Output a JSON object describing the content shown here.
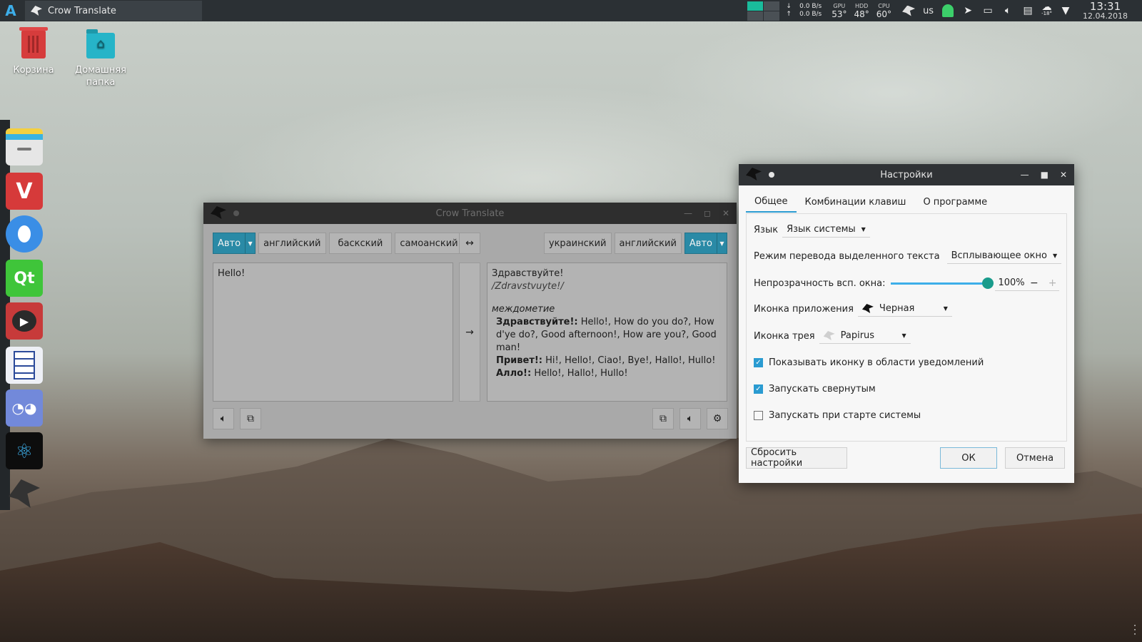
{
  "taskbar": {
    "task_title": "Crow Translate",
    "net_down": "0.0 B/s",
    "net_up": "0.0 B/s",
    "sensors": [
      {
        "label": "GPU",
        "value": "53°"
      },
      {
        "label": "HDD",
        "value": "48°"
      },
      {
        "label": "CPU",
        "value": "60°"
      }
    ],
    "keyboard_layout": "us",
    "weather_temp": "-18°",
    "time": "13:31",
    "date": "12.04.2018"
  },
  "desktop": {
    "trash_label": "Корзина",
    "home_label": "Домашняя папка"
  },
  "dock": {
    "qt_label": "Qt"
  },
  "crow": {
    "title": "Crow Translate",
    "source_langs": [
      "Авто",
      "английский",
      "баскский",
      "самоанский"
    ],
    "target_langs": [
      "украинский",
      "английский",
      "Авто"
    ],
    "swap_icon": "↔",
    "translate_icon": "→",
    "source_text": "Hello!",
    "result": {
      "main": "Здравствуйте!",
      "translit": "/Zdravstvuyte!/",
      "part_of_speech": "междометие",
      "entries": [
        {
          "word": "Здравствуйте!:",
          "meaning": "Hello!, How do you do?, How d'ye do?, Good afternoon!, How are you?, Good man!"
        },
        {
          "word": "Привет!:",
          "meaning": "Hi!, Hello!, Ciao!, Bye!, Hallo!, Hullo!"
        },
        {
          "word": "Алло!:",
          "meaning": "Hello!, Hallo!, Hullo!"
        }
      ]
    }
  },
  "settings": {
    "title": "Настройки",
    "tabs": [
      "Общее",
      "Комбинации клавиш",
      "О программе"
    ],
    "language_label": "Язык",
    "language_value": "Язык системы",
    "translation_mode_label": "Режим перевода выделенного текста",
    "translation_mode_value": "Всплывающее окно",
    "opacity_label": "Непрозрачность всп. окна:",
    "opacity_value": "100%",
    "opacity_fraction": 1.0,
    "app_icon_label": "Иконка приложения",
    "app_icon_value": "Черная",
    "tray_icon_label": "Иконка трея",
    "tray_icon_value": "Papirus",
    "checkboxes": [
      {
        "label": "Показывать иконку в области уведомлений",
        "checked": true
      },
      {
        "label": "Запускать свернутым",
        "checked": true
      },
      {
        "label": "Запускать при старте системы",
        "checked": false
      }
    ],
    "reset_button": "Сбросить настройки",
    "ok_button": "ОК",
    "cancel_button": "Отмена"
  },
  "colors": {
    "accent": "#2a8aa6",
    "slider": "#1a9c8c",
    "checkbox": "#2a9bd1",
    "panel": "#2b3034"
  }
}
